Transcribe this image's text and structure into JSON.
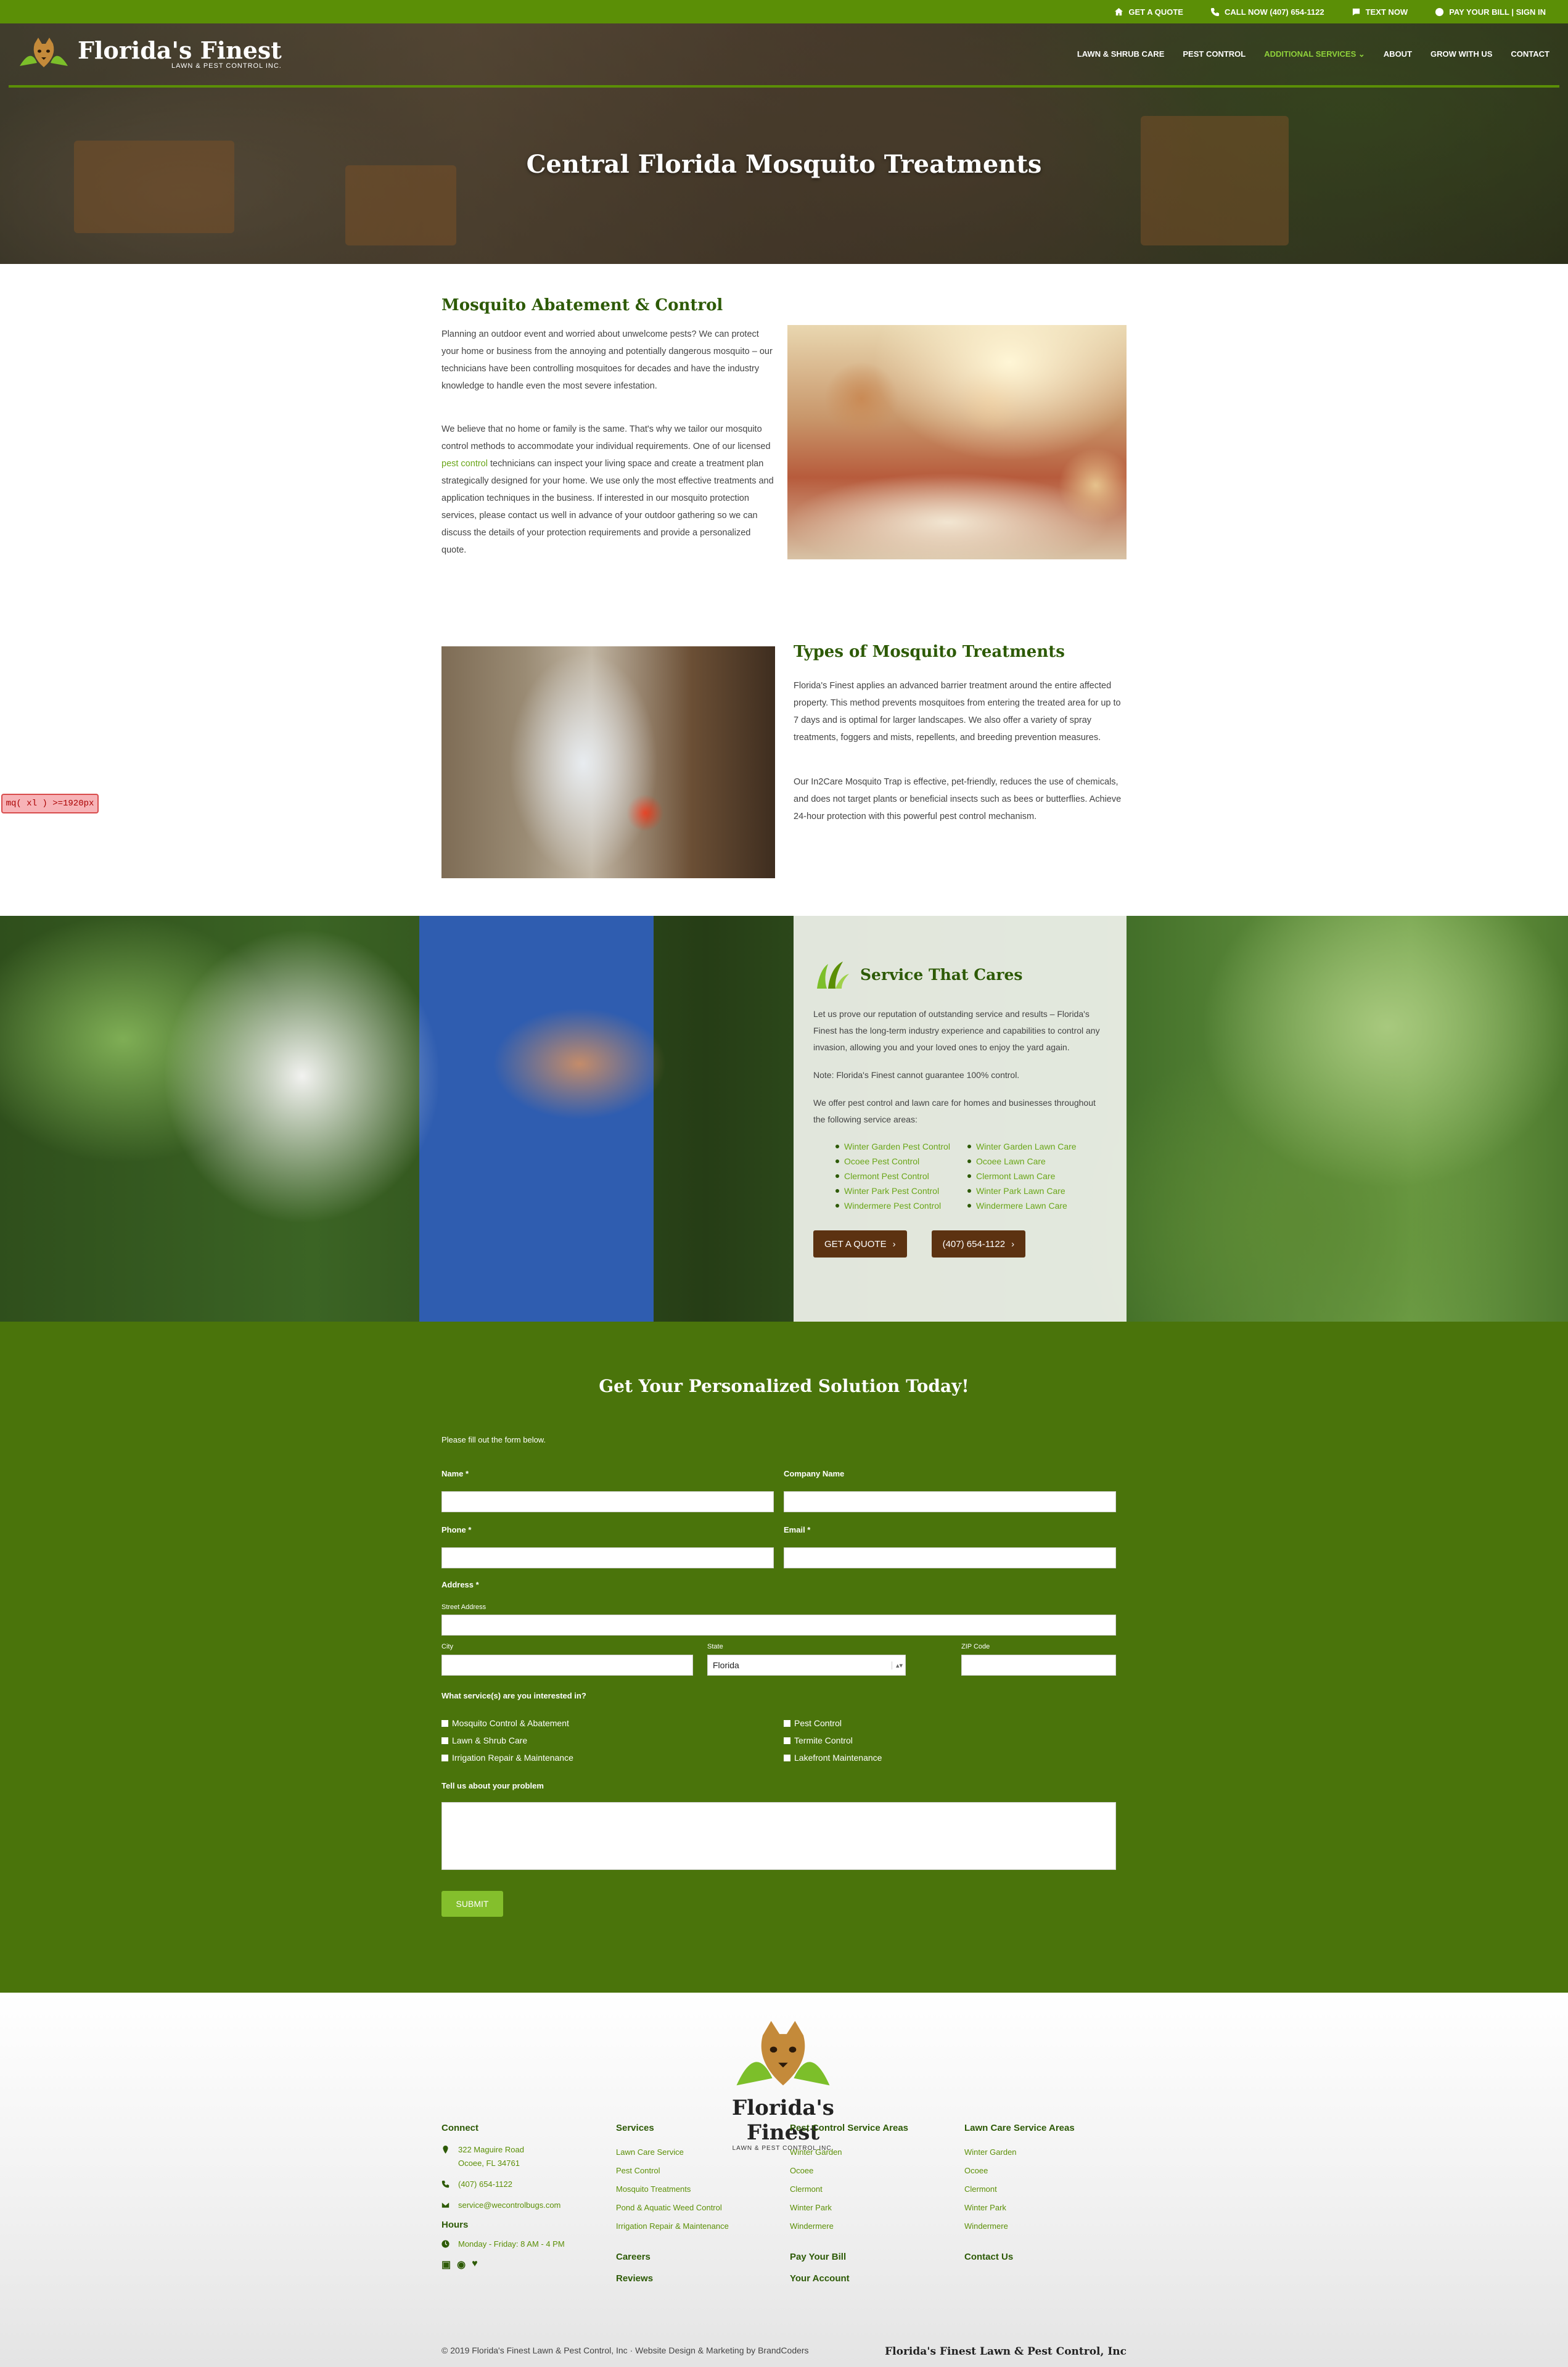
{
  "topbar": {
    "quote": "GET A QUOTE",
    "call": "CALL NOW (407) 654-1122",
    "text": "TEXT NOW",
    "pay": "PAY YOUR BILL | SIGN IN"
  },
  "brand": {
    "name": "Florida's Finest",
    "sub": "LAWN & PEST CONTROL INC."
  },
  "nav": {
    "items": [
      "LAWN & SHRUB CARE",
      "PEST CONTROL",
      "ADDITIONAL SERVICES",
      "ABOUT",
      "GROW WITH US",
      "CONTACT"
    ],
    "active_index": 2
  },
  "hero": {
    "title": "Central Florida Mosquito Treatments"
  },
  "section1": {
    "title": "Mosquito Abatement & Control",
    "p1": "Planning an outdoor event and worried about unwelcome pests? We can protect your home or business from the annoying and potentially dangerous mosquito – our technicians have been controlling mosquitoes for decades and have the industry knowledge to handle even the most severe infestation.",
    "p2_before": "We believe that no home or family is the same. That's why we tailor our mosquito control methods to accommodate your individual requirements. One of our licensed ",
    "p2_link": "pest control",
    "p2_after": " technicians can inspect your living space and create a treatment plan strategically designed for your home. We use only the most effective treatments and application techniques in the business. If interested in our mosquito protection services, please contact us well in advance of your outdoor gathering so we can discuss the details of your protection requirements and provide a personalized quote."
  },
  "section2": {
    "title": "Types of Mosquito Treatments",
    "p1": "Florida's Finest applies an advanced barrier treatment around the entire affected property. This method prevents mosquitoes from entering the treated area for up to 7 days and is optimal for larger landscapes. We also offer a variety of spray treatments, foggers and mists, repellents, and breeding prevention measures.",
    "p2": "Our In2Care Mosquito Trap is effective, pet-friendly, reduces the use of chemicals, and does not target plants or beneficial insects such as bees or butterflies. Achieve 24-hour protection with this powerful pest control mechanism."
  },
  "debug_badge": "mq( xl ) >=1920px",
  "service": {
    "title": "Service That Cares",
    "p1": "Let us prove our reputation of outstanding service and results – Florida's Finest has the long-term industry experience and capabilities to control any invasion, allowing you and your loved ones to enjoy the yard again.",
    "p2": "Note: Florida's Finest cannot guarantee 100% control.",
    "p3": "We offer pest control and lawn care for homes and businesses throughout the following service areas:",
    "pest_areas": [
      "Winter Garden Pest Control",
      "Ocoee Pest Control",
      "Clermont Pest Control",
      "Winter Park Pest Control",
      "Windermere Pest Control"
    ],
    "lawn_areas": [
      "Winter Garden Lawn Care",
      "Ocoee Lawn Care",
      "Clermont Lawn Care",
      "Winter Park Lawn Care",
      "Windermere Lawn Care"
    ],
    "btn_quote": "GET A QUOTE",
    "btn_phone": "(407) 654-1122"
  },
  "form": {
    "heading": "Get Your Personalized Solution Today!",
    "intro": "Please fill out the form below.",
    "name_label": "Name *",
    "company_label": "Company Name",
    "phone_label": "Phone *",
    "email_label": "Email *",
    "address_label": "Address *",
    "street_label": "Street Address",
    "city_label": "City",
    "state_label": "State",
    "state_value": "Florida",
    "zip_label": "ZIP Code",
    "services_label": "What service(s) are you interested in?",
    "services_left": [
      "Mosquito Control & Abatement",
      "Lawn & Shrub Care",
      "Irrigation Repair & Maintenance"
    ],
    "services_right": [
      "Pest Control",
      "Termite Control",
      "Lakefront Maintenance"
    ],
    "problem_label": "Tell us about your problem",
    "submit": "SUBMIT"
  },
  "footer": {
    "connect": {
      "title": "Connect",
      "address1": "322 Maguire Road",
      "address2": "Ocoee, FL 34761",
      "phone": "(407) 654-1122",
      "email": "service@wecontrolbugs.com",
      "hours_title": "Hours",
      "hours": "Monday - Friday: 8 AM - 4 PM"
    },
    "services": {
      "title": "Services",
      "links": [
        "Lawn Care Service",
        "Pest Control",
        "Mosquito Treatments",
        "Pond & Aquatic Weed Control",
        "Irrigation Repair & Maintenance"
      ],
      "extra1": "Careers",
      "extra2": "Reviews"
    },
    "pest_areas": {
      "title": "Pest Control Service Areas",
      "links": [
        "Winter Garden",
        "Ocoee",
        "Clermont",
        "Winter Park",
        "Windermere"
      ],
      "extra1": "Pay Your Bill",
      "extra2": "Your Account"
    },
    "lawn_areas": {
      "title": "Lawn Care Service Areas",
      "links": [
        "Winter Garden",
        "Ocoee",
        "Clermont",
        "Winter Park",
        "Windermere"
      ],
      "extra1": "Contact Us"
    },
    "copyright": "© 2019 Florida's Finest Lawn & Pest Control, Inc · Website Design & Marketing by BrandCoders",
    "company": "Florida's Finest Lawn & Pest Control, Inc"
  },
  "colors": {
    "brand_green": "#5b8f06",
    "dark_green": "#2d5a06",
    "form_bg": "#4a740b",
    "button_brown": "#5c3211",
    "submit_green": "#84bf2c"
  }
}
